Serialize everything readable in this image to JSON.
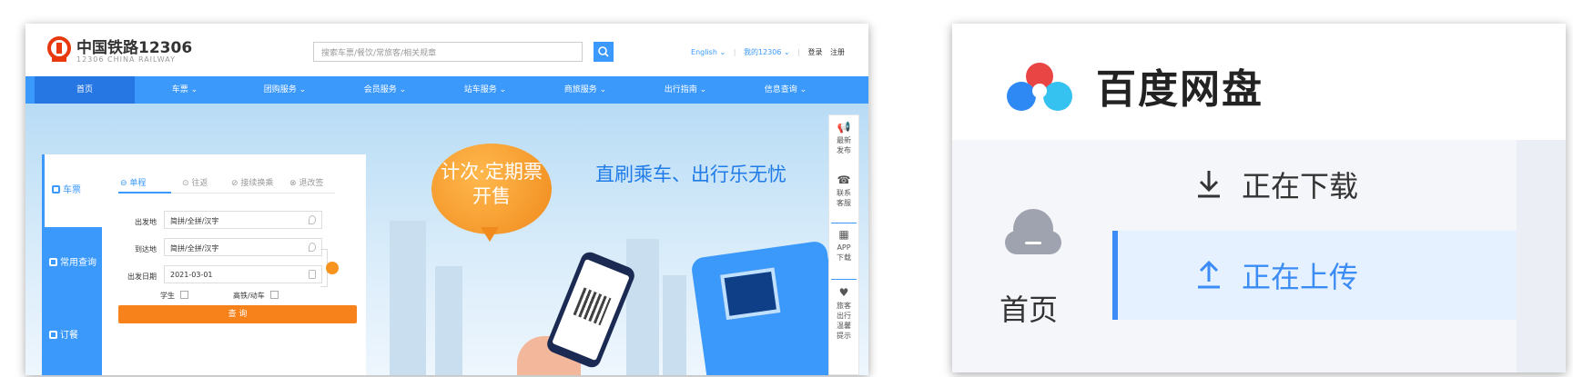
{
  "rail12306": {
    "brand": {
      "name_cn": "中国铁路12306",
      "name_en": "12306 CHINA RAILWAY"
    },
    "search": {
      "placeholder": "搜索车票/餐饮/常旅客/相关规章"
    },
    "header_links": {
      "language": "English ⌄",
      "my_account": "我的12306 ⌄",
      "login": "登录",
      "register": "注册",
      "separator": "|"
    },
    "nav": [
      "首页",
      "车票 ⌄",
      "团购服务 ⌄",
      "会员服务 ⌄",
      "站车服务 ⌄",
      "商旅服务 ⌄",
      "出行指南 ⌄",
      "信息查询 ⌄"
    ],
    "booking": {
      "side_tabs": [
        "车票",
        "常用查询",
        "订餐"
      ],
      "trip_types": [
        "单程",
        "往返",
        "接续换乘",
        "退改签"
      ],
      "from_label": "出发地",
      "from_value": "简拼/全拼/汉字",
      "to_label": "到达地",
      "to_value": "简拼/全拼/汉字",
      "date_label": "出发日期",
      "date_value": "2021-03-01",
      "student_label": "学生",
      "highspeed_label": "高铁/动车",
      "query_button": "查 询"
    },
    "promo": {
      "bubble_line1": "计次·定期票",
      "bubble_line2": "开售",
      "slogan": "直刷乘车、出行乐无忧"
    },
    "rail": [
      {
        "label_line1": "最新",
        "label_line2": "发布",
        "icon": "megaphone-icon"
      },
      {
        "label_line1": "联系",
        "label_line2": "客服",
        "icon": "phone-icon"
      },
      {
        "label_line1": "APP",
        "label_line2": "下载",
        "icon": "qr-icon"
      },
      {
        "label_line1": "旅客",
        "label_line2": "出行",
        "label_line3": "温馨",
        "label_line4": "提示",
        "icon": "heart-icon"
      }
    ],
    "colors": {
      "primary": "#3b99fc",
      "nav_active": "#2676e3",
      "accent": "#f7821b",
      "brand_red": "#e8380d"
    }
  },
  "baidu": {
    "title": "百度网盘",
    "home_label": "首页",
    "rows": [
      {
        "label": "正在下载",
        "icon": "download-icon",
        "active": false
      },
      {
        "label": "正在上传",
        "icon": "upload-icon",
        "active": true
      }
    ],
    "colors": {
      "accent": "#3b8cf5",
      "active_bg": "#e6f1ff"
    }
  }
}
